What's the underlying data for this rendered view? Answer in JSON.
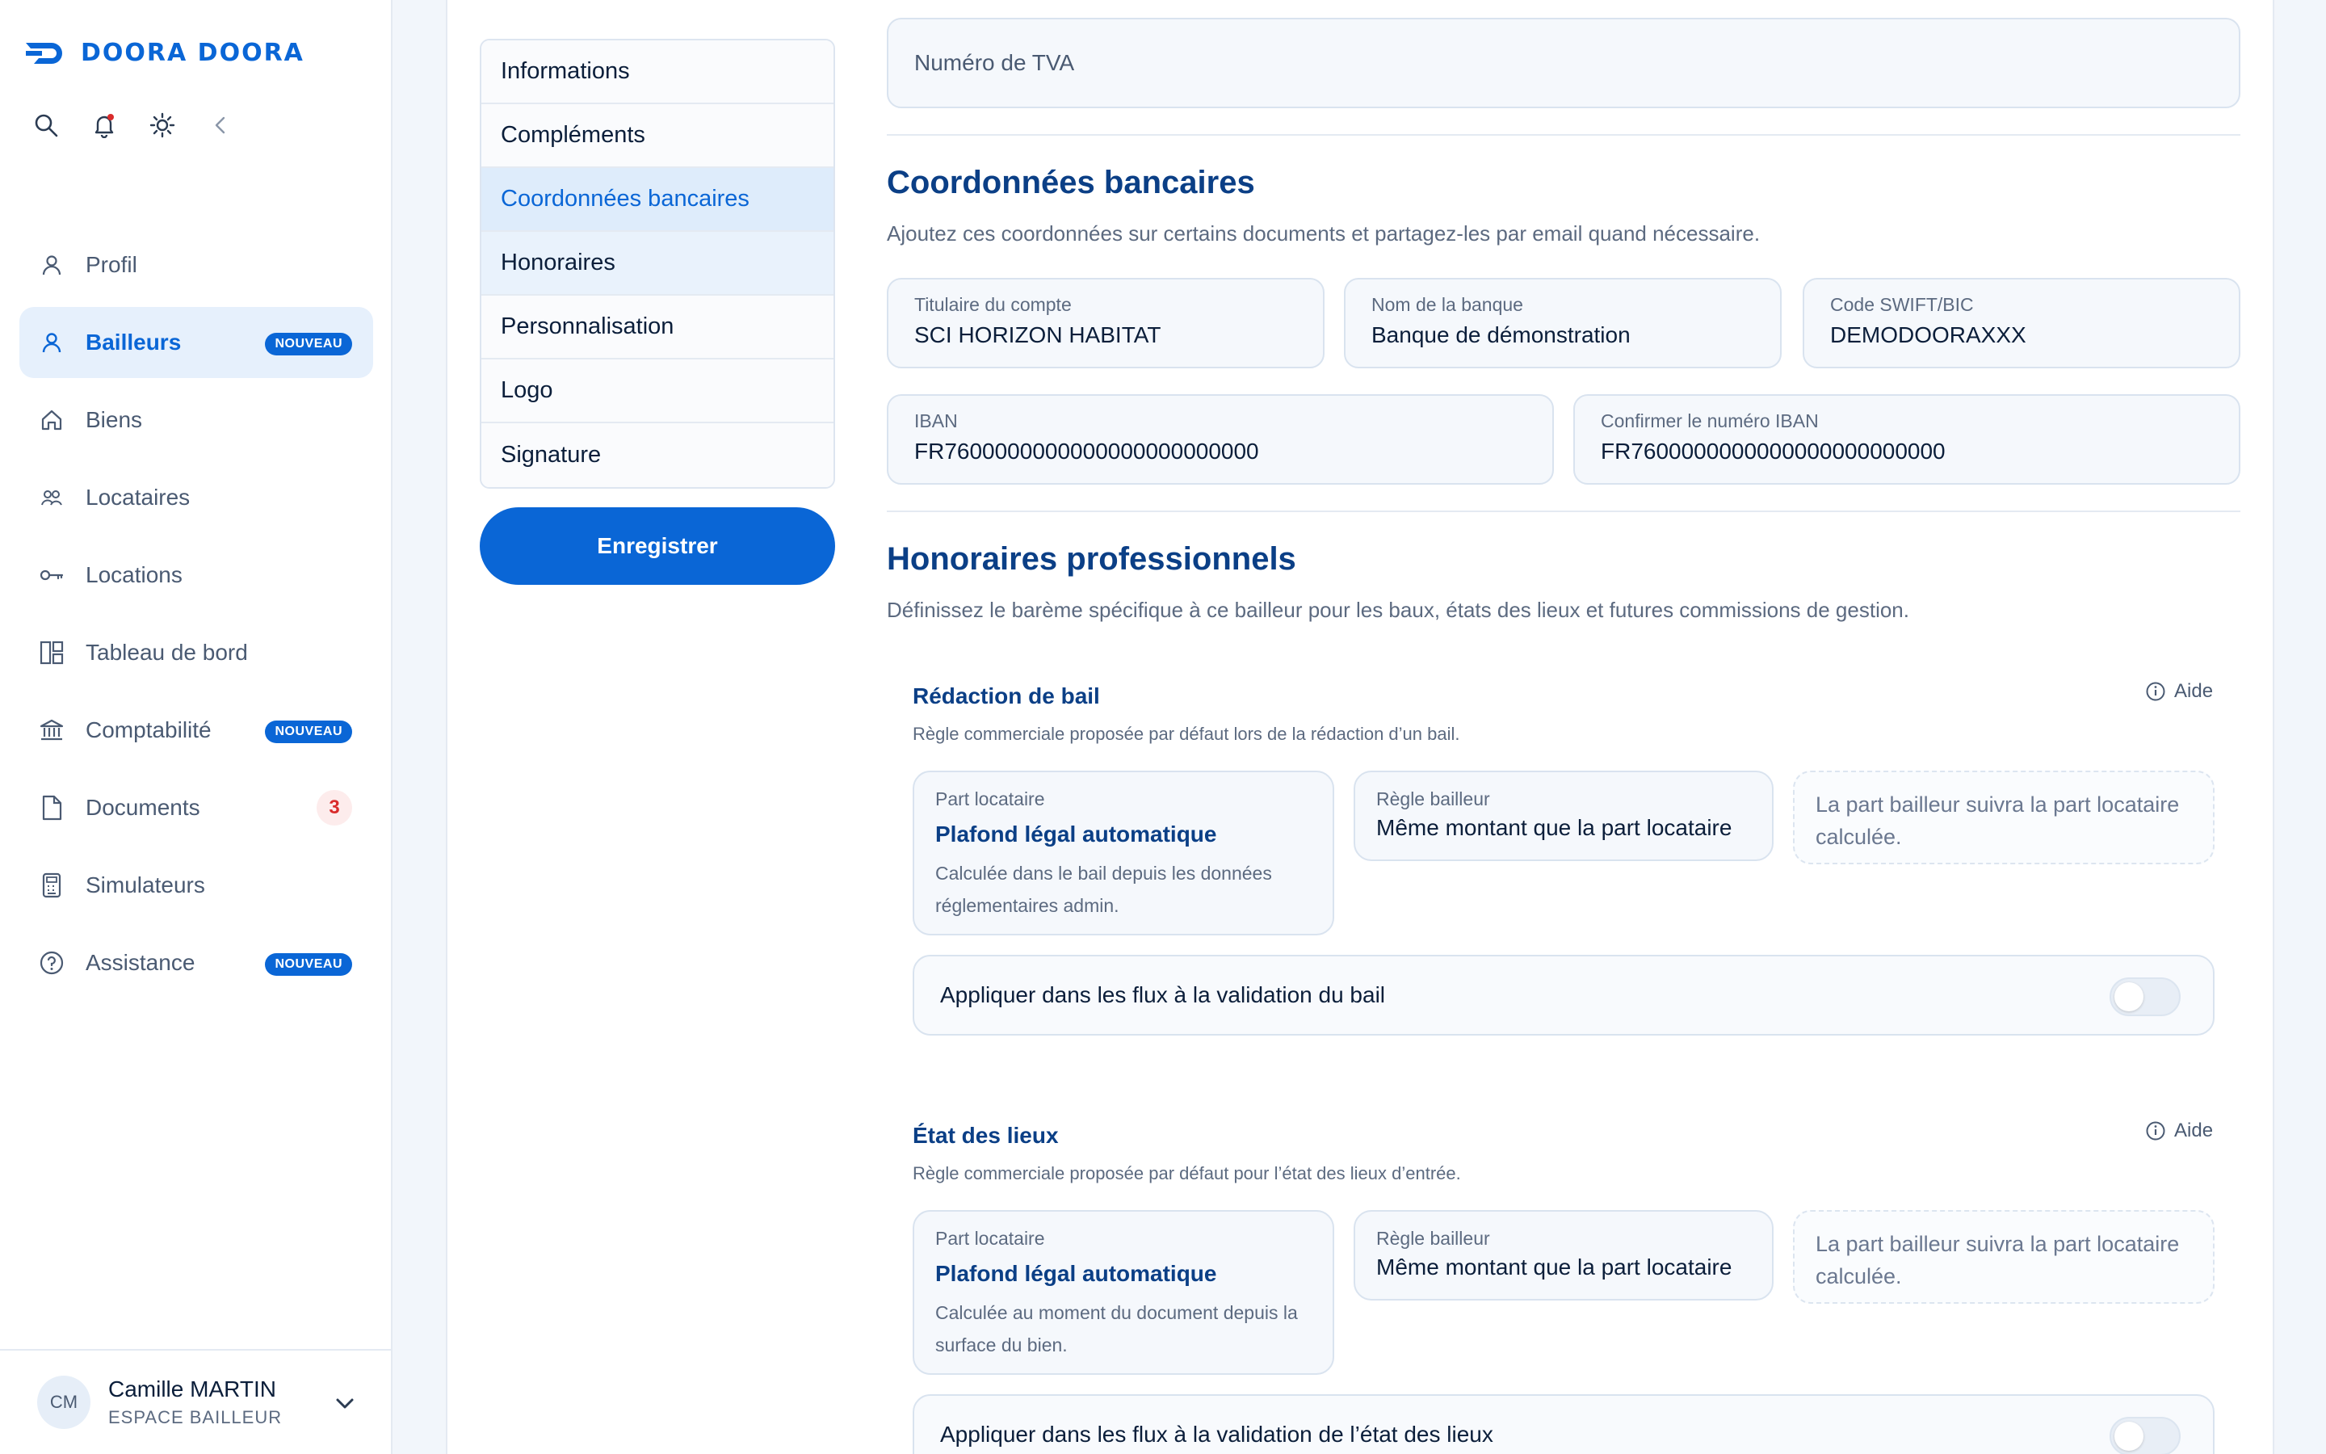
{
  "app": {
    "logo": "DOORA DOORA"
  },
  "sidebar": {
    "items": [
      {
        "label": "Profil",
        "icon": "user-icon"
      },
      {
        "label": "Bailleurs",
        "icon": "user-icon",
        "badge": "NOUVEAU",
        "active": true
      },
      {
        "label": "Biens",
        "icon": "home-icon"
      },
      {
        "label": "Locataires",
        "icon": "users-icon"
      },
      {
        "label": "Locations",
        "icon": "key-icon"
      },
      {
        "label": "Tableau de bord",
        "icon": "dashboard-icon"
      },
      {
        "label": "Comptabilité",
        "icon": "bank-icon",
        "badge": "NOUVEAU"
      },
      {
        "label": "Documents",
        "icon": "document-icon",
        "count": "3"
      },
      {
        "label": "Simulateurs",
        "icon": "calculator-icon"
      },
      {
        "label": "Assistance",
        "icon": "help-icon",
        "badge": "NOUVEAU"
      }
    ],
    "user": {
      "initials": "CM",
      "name": "Camille MARTIN",
      "role": "ESPACE BAILLEUR"
    }
  },
  "tabs": [
    "Informations",
    "Compléments",
    "Coordonnées bancaires",
    "Honoraires",
    "Personnalisation",
    "Logo",
    "Signature"
  ],
  "active_tab": "Coordonnées bancaires",
  "save_label": "Enregistrer",
  "tva": {
    "placeholder": "Numéro de TVA"
  },
  "bank": {
    "title": "Coordonnées bancaires",
    "subtitle": "Ajoutez ces coordonnées sur certains documents et partagez-les par email quand nécessaire.",
    "holder_label": "Titulaire du compte",
    "holder_value": "SCI HORIZON HABITAT",
    "bank_label": "Nom de la banque",
    "bank_value": "Banque de démonstration",
    "swift_label": "Code SWIFT/BIC",
    "swift_value": "DEMODOORAXXX",
    "iban_label": "IBAN",
    "iban_value": "FR7600000000000000000000000",
    "iban_confirm_label": "Confirmer le numéro IBAN",
    "iban_confirm_value": "FR7600000000000000000000000"
  },
  "fees": {
    "title": "Honoraires professionnels",
    "subtitle": "Définissez le barème spécifique à ce bailleur pour les baux, états des lieux et futures commissions de gestion.",
    "aide": "Aide",
    "lease": {
      "title": "Rédaction de bail",
      "desc": "Règle commerciale proposée par défaut lors de la rédaction d’un bail.",
      "tenant_label": "Part locataire",
      "tenant_value": "Plafond légal automatique",
      "tenant_desc": "Calculée dans le bail depuis les données réglementaires admin.",
      "landlord_label": "Règle bailleur",
      "landlord_value": "Même montant que la part locataire",
      "note": "La part bailleur suivra la part locataire calculée.",
      "toggle_label": "Appliquer dans les flux à la validation du bail",
      "toggle_on": false
    },
    "inventory": {
      "title": "État des lieux",
      "desc": "Règle commerciale proposée par défaut pour l’état des lieux d’entrée.",
      "tenant_label": "Part locataire",
      "tenant_value": "Plafond légal automatique",
      "tenant_desc": "Calculée au moment du document depuis la surface du bien.",
      "landlord_label": "Règle bailleur",
      "landlord_value": "Même montant que la part locataire",
      "note": "La part bailleur suivra la part locataire calculée.",
      "toggle_label": "Appliquer dans les flux à la validation de l’état des lieux",
      "toggle_on": false
    }
  },
  "colors": {
    "accent": "#0a66d6",
    "heading": "#0b3f86",
    "badge_alert": "#d92b2b"
  }
}
